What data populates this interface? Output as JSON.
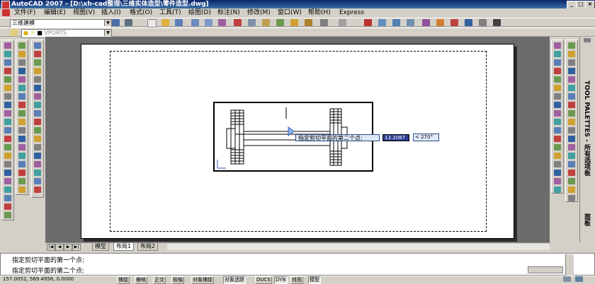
{
  "window": {
    "title": "AutoCAD 2007 - [D:\\xh-cad整理\\三维实体造型\\零件造型.dwg]"
  },
  "menu": {
    "items": [
      "文件(F)",
      "编辑(E)",
      "视图(V)",
      "插入(I)",
      "格式(O)",
      "工具(T)",
      "绘图(D)",
      "标注(N)",
      "修改(M)",
      "窗口(W)",
      "帮助(H)",
      "Express"
    ]
  },
  "toolbar": {
    "workspace": "三维建模",
    "layer_combo": "VPORTS"
  },
  "drawing": {
    "tooltip_prompt": "指定剪切平面的第二个点:",
    "dyn_distance": "13.2087",
    "dyn_angle": "< 270°",
    "accent_selected": "#2f3b8f",
    "paper_color": "#ffffff",
    "background_color": "#6b6b6b"
  },
  "tabs": {
    "items": [
      "模型",
      "布局1",
      "布局2"
    ],
    "active": "布局1"
  },
  "command": {
    "history": "指定剪切平面的第一个点:",
    "current": "指定剪切平面的第二个点:"
  },
  "status": {
    "coords": "157.0052, 569.4956, 0.0000",
    "buttons": [
      "捕捉",
      "栅格",
      "正交",
      "极轴",
      "对象捕捉",
      "对象追踪",
      "DUCS",
      "DYN",
      "线宽",
      "模型"
    ],
    "active_buttons": [
      "对象追踪",
      "DYN",
      "模型"
    ]
  },
  "palette": {
    "label": "TOOL PALETTES - 所有选项板",
    "bottom_label": "面板"
  }
}
